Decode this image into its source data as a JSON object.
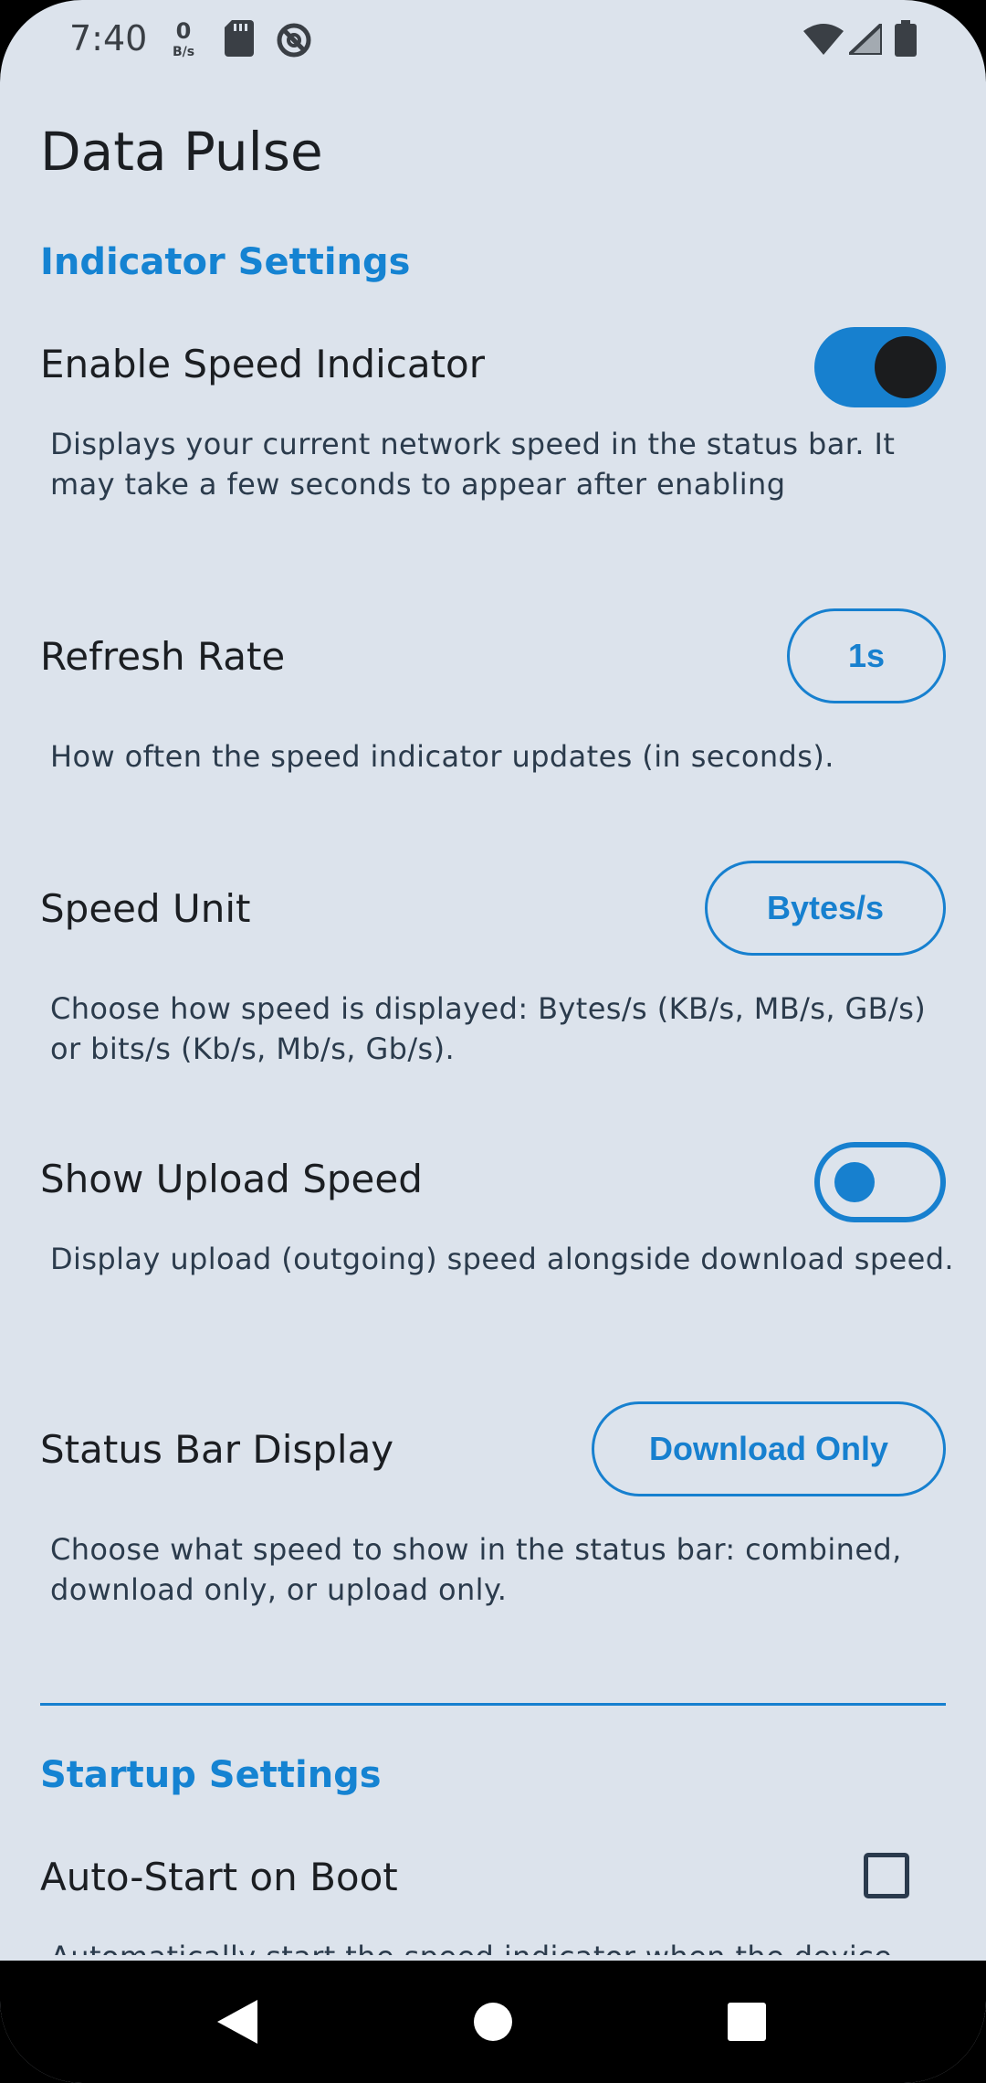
{
  "status_bar": {
    "time": "7:40",
    "speed_value": "0",
    "speed_unit": "B/s",
    "icons": [
      "sd-card-icon",
      "no-sync-icon",
      "wifi-icon",
      "cell-signal-icon",
      "battery-icon"
    ]
  },
  "app": {
    "title": "Data Pulse"
  },
  "sections": {
    "indicator": {
      "header": "Indicator Settings",
      "enable_speed": {
        "title": "Enable Speed Indicator",
        "summary": "Displays your current network speed in the status bar. It may take a few seconds to appear after enabling",
        "checked": true
      },
      "refresh_rate": {
        "title": "Refresh Rate",
        "value": "1s",
        "summary": "How often the speed indicator updates (in seconds)."
      },
      "speed_unit": {
        "title": "Speed Unit",
        "value": "Bytes/s",
        "summary": "Choose how speed is displayed: Bytes/s (KB/s, MB/s, GB/s) or bits/s (Kb/s, Mb/s, Gb/s)."
      },
      "show_upload": {
        "title": "Show Upload Speed",
        "summary": "Display upload (outgoing) speed alongside download speed.",
        "checked": false
      },
      "status_bar_display": {
        "title": "Status Bar Display",
        "value": "Download Only",
        "summary": "Choose what speed to show in the status bar: combined, download only, or upload only."
      }
    },
    "startup": {
      "header": "Startup Settings",
      "auto_start": {
        "title": "Auto-Start on Boot",
        "summary": "Automatically start the speed indicator when the device boots",
        "checked": false
      }
    }
  },
  "colors": {
    "background": "#dce3ec",
    "accent": "#1780cf",
    "text": "#1b1e22"
  },
  "nav_bar": {
    "buttons": [
      "back-icon",
      "home-icon",
      "recents-icon"
    ]
  }
}
